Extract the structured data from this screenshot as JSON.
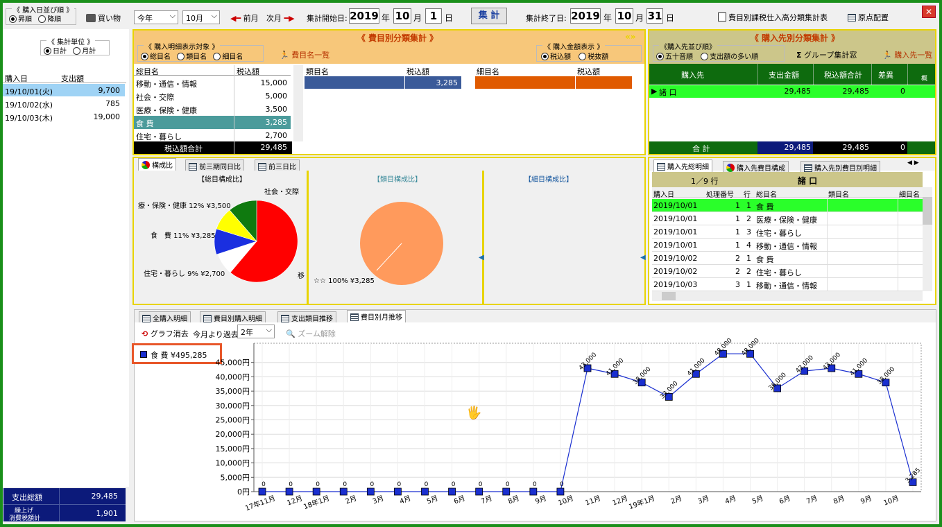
{
  "top": {
    "sort_group": "《 購入日並び順 》",
    "sort_asc": "昇順",
    "sort_desc": "降順",
    "shopping": "買い物",
    "year_select": "今年",
    "month_select": "10月",
    "prev_month": "前月",
    "next_month": "次月",
    "start_label": "集計開始日:",
    "start_year": "2019",
    "start_month": "10",
    "start_day": "1",
    "unit_year": "年",
    "unit_month": "月",
    "unit_day": "日",
    "aggregate_button": "集 計",
    "end_label": "集計終了日:",
    "end_year": "2019",
    "end_month": "10",
    "end_day": "31",
    "report_button": "費目別課税仕入高分類集計表",
    "layout_button": "原点配置",
    "close": "✕"
  },
  "left": {
    "unit_group": "《 集計単位 》",
    "daily": "日計",
    "monthly": "月計",
    "col_date": "購入日",
    "col_amount": "支出額",
    "rows": [
      {
        "date": "19/10/01(火)",
        "amount": "9,700"
      },
      {
        "date": "19/10/02(水)",
        "amount": "785"
      },
      {
        "date": "19/10/03(木)",
        "amount": "19,000"
      }
    ],
    "total_label": "支出総額",
    "total_value": "29,485",
    "tax_label1": "繰上げ",
    "tax_label2": "消費税額計",
    "tax_value": "1,901"
  },
  "expense": {
    "title": "《 費目別分類集計 》",
    "target_group": "《 購入明細表示対象 》",
    "opt_total": "総目名",
    "opt_class": "類目名",
    "opt_detail": "細目名",
    "list_button": "費目名一覧",
    "amount_group": "《 購入金額表示 》",
    "opt_taxin": "税込額",
    "opt_taxout": "税抜額",
    "col_name": "総目名",
    "col_amount": "税込額",
    "rows": [
      {
        "name": "移動・通信・情報",
        "amount": "15,000"
      },
      {
        "name": "社会・交際",
        "amount": "5,000"
      },
      {
        "name": "医療・保険・健康",
        "amount": "3,500"
      },
      {
        "name": "食 費",
        "amount": "3,285"
      },
      {
        "name": "住宅・暮らし",
        "amount": "2,700"
      }
    ],
    "total_label": "税込額合計",
    "total_value": "29,485",
    "class_col_name": "類目名",
    "class_col_amount": "税込額",
    "class_value": "3,285",
    "detail_col_name": "細目名",
    "detail_col_amount": "税込額"
  },
  "supplier": {
    "title": "《 購入先別分類集計 》",
    "sort_group": "《購入先並び順》",
    "opt_kana": "五十音順",
    "opt_amount": "支出額の多い順",
    "group_button": "グループ集計窓",
    "list_button": "購入先一覧",
    "col_supplier": "購入先",
    "col_spend": "支出金額",
    "col_taxin": "税込額合計",
    "col_diff": "差異",
    "col_extra": "概",
    "row_name": "諸 口",
    "row_spend": "29,485",
    "row_taxin": "29,485",
    "row_diff": "0",
    "total_label": "合 計",
    "total_spend": "29,485",
    "total_taxin": "29,485",
    "total_diff": "0"
  },
  "ratio": {
    "tab1": "構成比",
    "tab2": "前三期同日比",
    "tab3": "前三日比",
    "pane1_title": "【総目構成比】",
    "pane2_title": "【類目構成比】",
    "pane3_title": "【細目構成比】",
    "label_social": "社会・交際",
    "label_medical": "療・保険・健康 12% ¥3,500",
    "label_food": "食　費 11% ¥3,285",
    "label_housing": "住宅・暮らし 9% ¥2,700",
    "label_move": "移",
    "label_class": "☆☆ 100% ¥3,285"
  },
  "detail": {
    "tab1": "購入先総明細",
    "tab2": "購入先費目構成",
    "tab3": "購入先別費目別明細",
    "counter": "1／9 行",
    "supplier": "諸 口",
    "cols": [
      "購入日",
      "処理番号",
      "行",
      "総目名",
      "類目名",
      "細目名"
    ],
    "rows": [
      {
        "date": "2019/10/01",
        "no": "1",
        "line": "1",
        "name": "食 費"
      },
      {
        "date": "2019/10/01",
        "no": "1",
        "line": "2",
        "name": "医療・保険・健康"
      },
      {
        "date": "2019/10/01",
        "no": "1",
        "line": "3",
        "name": "住宅・暮らし"
      },
      {
        "date": "2019/10/01",
        "no": "1",
        "line": "4",
        "name": "移動・通信・情報"
      },
      {
        "date": "2019/10/02",
        "no": "2",
        "line": "1",
        "name": "食 費"
      },
      {
        "date": "2019/10/02",
        "no": "2",
        "line": "2",
        "name": "住宅・暮らし"
      },
      {
        "date": "2019/10/03",
        "no": "3",
        "line": "1",
        "name": "移動・通信・情報"
      }
    ]
  },
  "bottom": {
    "tab1": "全購入明細",
    "tab2": "費目別購入明細",
    "tab3": "支出類目推移",
    "tab4": "費目別月推移",
    "clear_graph": "グラフ消去",
    "past_label": "今月より過去",
    "period_select": "2年",
    "zoom_reset": "ズーム解除"
  },
  "chart_data": {
    "type": "line",
    "series": [
      {
        "name": "食 費 ¥495,285",
        "values": [
          0,
          0,
          0,
          0,
          0,
          0,
          0,
          0,
          0,
          0,
          0,
          0,
          43000,
          41000,
          38000,
          33000,
          41000,
          48000,
          48000,
          36000,
          42000,
          43000,
          41000,
          38000,
          3285
        ]
      }
    ],
    "categories": [
      "17年11月",
      "12月",
      "18年1月",
      "2月",
      "3月",
      "4月",
      "5月",
      "6月",
      "7月",
      "8月",
      "9月",
      "10月",
      "11月",
      "12月",
      "19年1月",
      "2月",
      "3月",
      "4月",
      "5月",
      "6月",
      "7月",
      "8月",
      "9月",
      "10月"
    ],
    "data_labels": [
      "0",
      "0",
      "0",
      "0",
      "0",
      "0",
      "0",
      "0",
      "0",
      "0",
      "0",
      "0",
      "43,000",
      "41,000",
      "38,000",
      "33,000",
      "41,000",
      "48,000",
      "48,000",
      "36,000",
      "42,000",
      "43,000",
      "41,000",
      "38,000",
      "3,285"
    ],
    "y_ticks": [
      "0円",
      "5,000円",
      "10,000円",
      "15,000円",
      "20,000円",
      "25,000円",
      "30,000円",
      "35,000円",
      "40,000円",
      "45,000円"
    ],
    "ylim": [
      0,
      50000
    ],
    "grid": true,
    "legend": "top-left",
    "color": "#1a2fd0"
  }
}
